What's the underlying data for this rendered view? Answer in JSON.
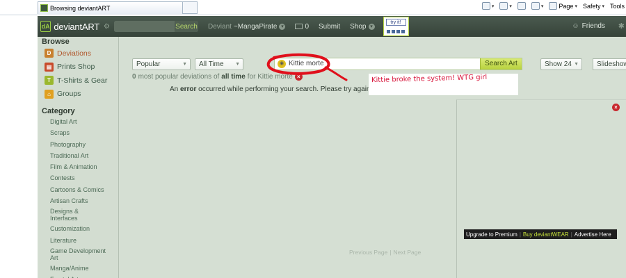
{
  "browser": {
    "tab_title": "Browsing deviantART",
    "commands": [
      "Page",
      "Safety",
      "Tools"
    ]
  },
  "nav": {
    "logo_text": "deviantART",
    "search_button": "Search",
    "deviant_label": "Deviant",
    "username": "~MangaPirate",
    "message_count": "0",
    "submit": "Submit",
    "shop": "Shop",
    "try_it": "try it!",
    "friends": "Friends"
  },
  "sidebar": {
    "browse_heading": "Browse",
    "items": [
      {
        "label": "Deviations",
        "icon": "deviations-icon",
        "active": true,
        "color": "#c8802e"
      },
      {
        "label": "Prints Shop",
        "icon": "prints-icon",
        "color": "#c84a2a"
      },
      {
        "label": "T-Shirts & Gear",
        "icon": "tshirt-icon",
        "color": "#9ab82e"
      },
      {
        "label": "Groups",
        "icon": "groups-icon",
        "color": "#e0a020"
      }
    ],
    "category_heading": "Category",
    "categories": [
      "Digital Art",
      "Scraps",
      "Photography",
      "Traditional Art",
      "Film & Animation",
      "Contests",
      "Cartoons & Comics",
      "Artisan Crafts",
      "Designs & Interfaces",
      "Customization",
      "Literature",
      "Game Development Art",
      "Manga/Anime",
      "Fractal Art"
    ]
  },
  "filters": {
    "sort": "Popular",
    "time": "All Time",
    "show": "Show 24",
    "slideshow": "Slideshow"
  },
  "search": {
    "query": "Kittie morte",
    "button": "Search Art"
  },
  "results": {
    "count": "0",
    "pre": "most popular deviations of",
    "period": "all time",
    "for_text": "for Kittie morte",
    "error_pre": "An",
    "error_word": "error",
    "error_post": "occurred while performing your search. Please try again"
  },
  "annotation": {
    "text": "Kittie broke the system! WTG girl",
    "color": "#d8143a"
  },
  "ad": {
    "links": [
      "Upgrade to Premium",
      "Buy deviantWEAR",
      "Advertise Here"
    ]
  },
  "pager": {
    "previous": "Previous Page",
    "next": "Next Page"
  }
}
